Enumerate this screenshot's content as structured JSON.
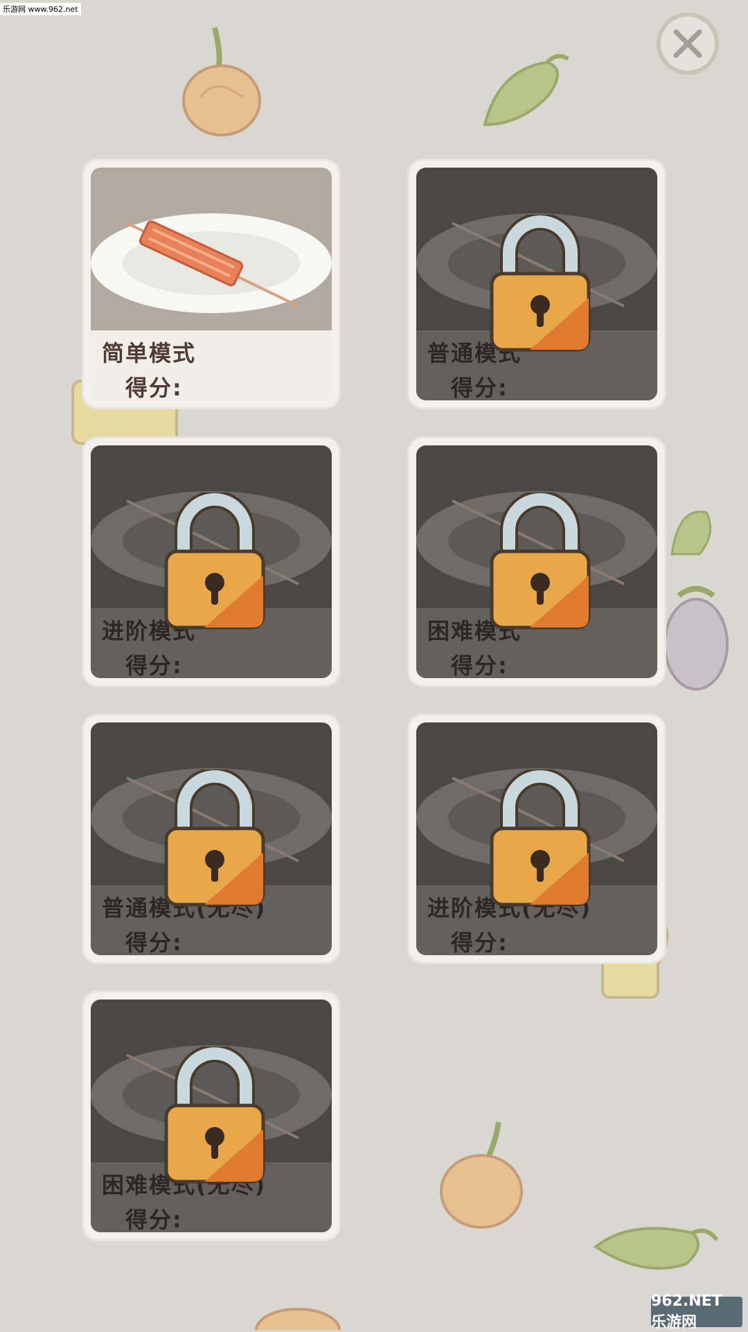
{
  "watermark_top": "乐游网 www.962.net",
  "watermark_bottom": "962.NET 乐游网",
  "close_icon": "close-icon",
  "colors": {
    "background": "#d9d8d0",
    "card_frame": "#f2f1ec",
    "locked_panel": "#4a4844",
    "text": "#523a34",
    "lock_gold": "#e0a040"
  },
  "modes": [
    {
      "name": "简单模式",
      "score_label": "得分:",
      "locked": false
    },
    {
      "name": "普通模式",
      "score_label": "得分:",
      "locked": true
    },
    {
      "name": "进阶模式",
      "score_label": "得分:",
      "locked": true
    },
    {
      "name": "困难模式",
      "score_label": "得分:",
      "locked": true
    },
    {
      "name": "普通模式(无尽)",
      "score_label": "得分:",
      "locked": true
    },
    {
      "name": "进阶模式(无尽)",
      "score_label": "得分:",
      "locked": true
    },
    {
      "name": "困难模式(无尽)",
      "score_label": "得分:",
      "locked": true
    }
  ]
}
